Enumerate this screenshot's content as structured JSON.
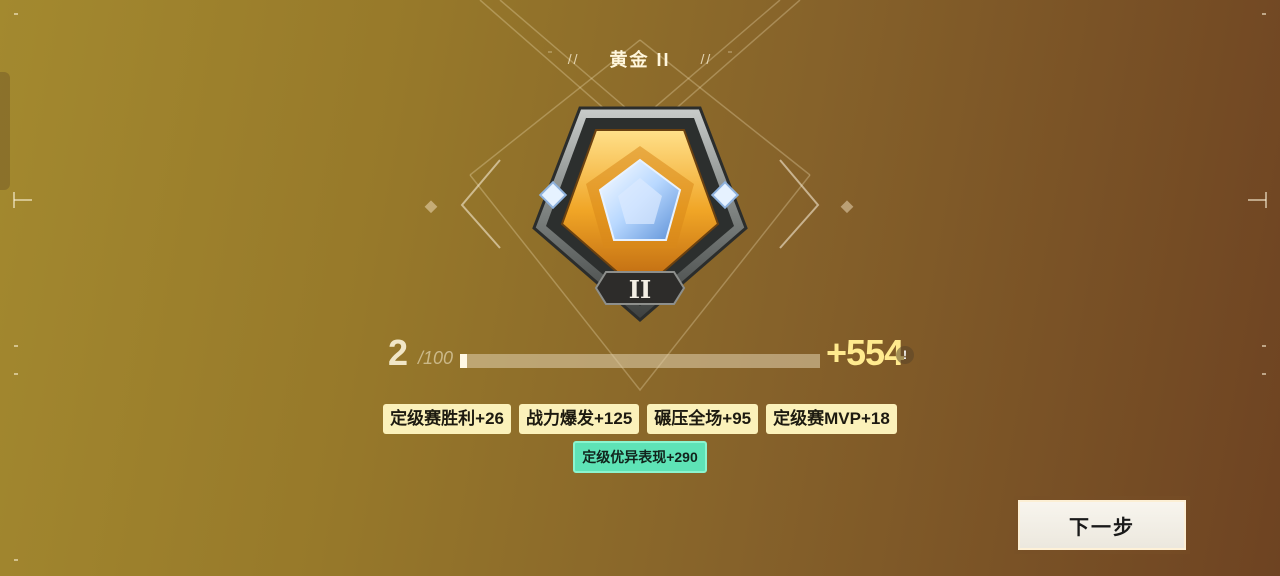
{
  "rank": {
    "title": "黄金 II",
    "roman": "II",
    "left_deco": "//",
    "right_deco": "//"
  },
  "progress": {
    "current": "2",
    "max": "/100",
    "fraction": 0.02,
    "gain": "+554",
    "info_icon": "!"
  },
  "bonuses": [
    {
      "label": "定级赛胜利+26"
    },
    {
      "label": "战力爆发+125"
    },
    {
      "label": "碾压全场+95"
    },
    {
      "label": "定级赛MVP+18"
    }
  ],
  "highlight_bonus": {
    "label": "定级优异表现+290"
  },
  "actions": {
    "next_label": "下一步"
  },
  "colors": {
    "tag_bg": "#fbf1ba",
    "highlight_bg": "#5ee3b6",
    "gain_color": "#ffea8e"
  },
  "icons": {
    "badge": "gold-pentagon-rank-badge-icon",
    "info": "info-icon"
  }
}
